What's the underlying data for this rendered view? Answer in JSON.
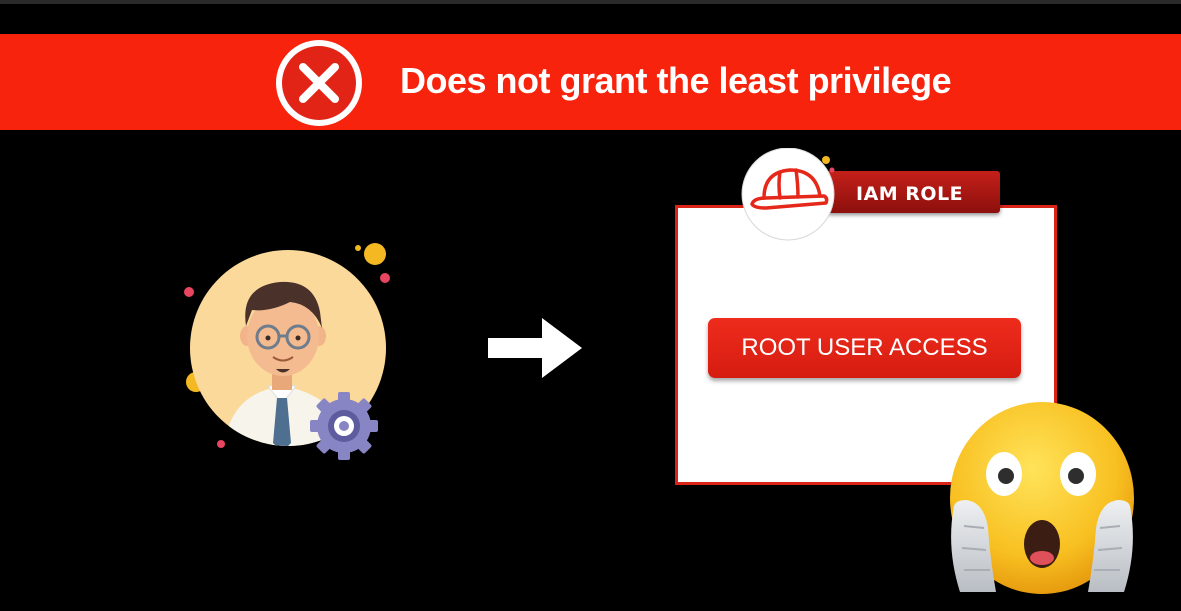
{
  "banner": {
    "title": "Does not grant the least privilege",
    "color": "#f7230c",
    "status_icon": "cross-mark-icon"
  },
  "user": {
    "icon": "developer-avatar-icon",
    "settings_icon": "gear-icon"
  },
  "flow": {
    "icon": "right-arrow-icon"
  },
  "iam_role": {
    "tag_label": "IAM ROLE",
    "badge_icon": "hard-hat-icon",
    "access_button_label": "ROOT USER ACCESS",
    "accent_color": "#e5281a"
  },
  "reaction": {
    "icon": "face-screaming-in-fear-emoji"
  }
}
